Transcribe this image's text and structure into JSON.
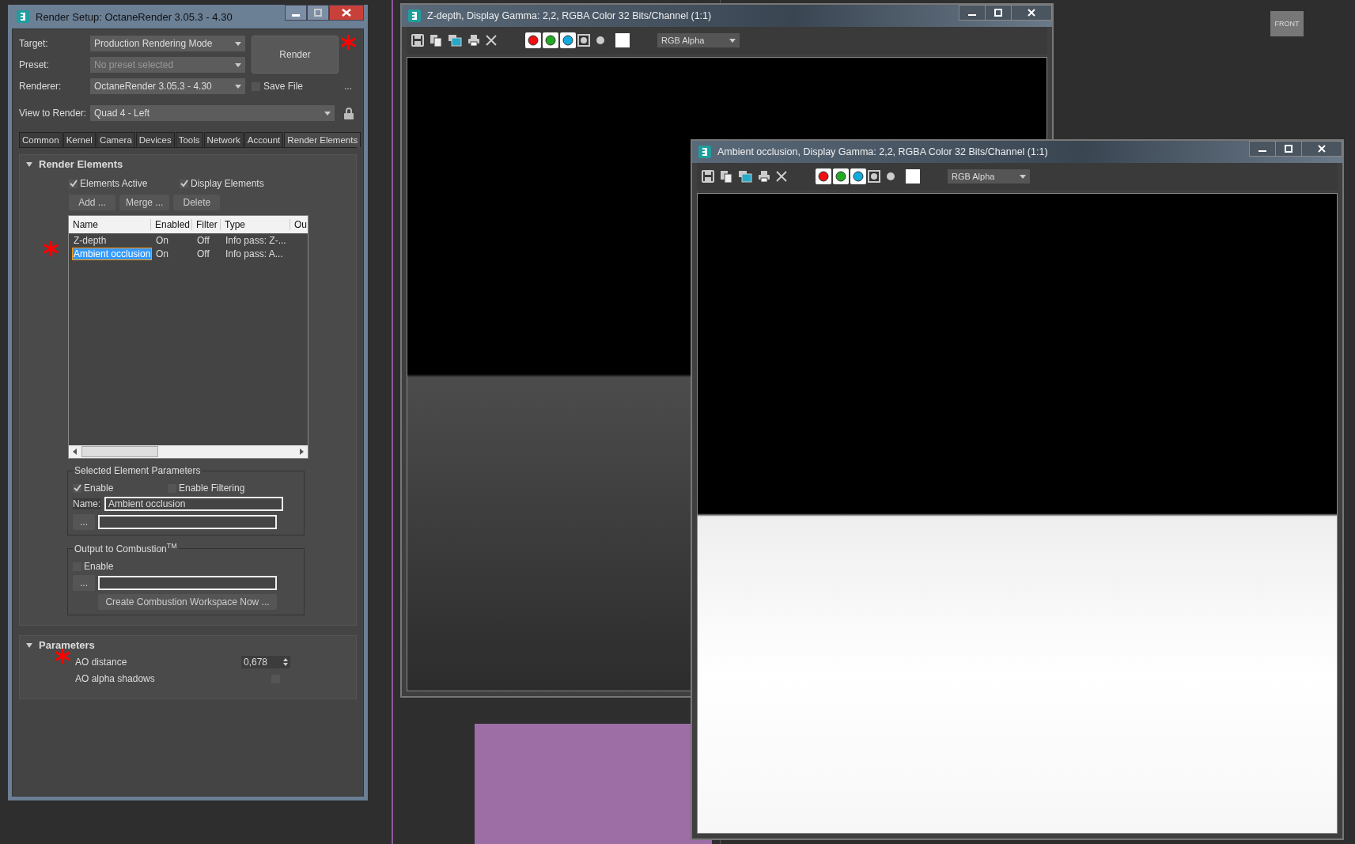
{
  "view_cube": {
    "label": "FRONT"
  },
  "render_setup": {
    "title": "Render Setup: OctaneRender 3.05.3 - 4.30",
    "fields": [
      {
        "label": "Target:",
        "value": "Production Rendering Mode",
        "disabled": false
      },
      {
        "label": "Preset:",
        "value": "No preset selected",
        "disabled": true
      },
      {
        "label": "Renderer:",
        "value": "OctaneRender 3.05.3 - 4.30",
        "disabled": false
      }
    ],
    "render_button": {
      "label": "Render",
      "marker": "*"
    },
    "save_file": {
      "label": "Save File",
      "checked": false
    },
    "more_button": "...",
    "view_to_render": {
      "label": "View to Render:",
      "value": "Quad 4 - Left"
    },
    "tabs": [
      {
        "label": "Common",
        "selected": false
      },
      {
        "label": "Kernel",
        "selected": false
      },
      {
        "label": "Camera",
        "selected": false
      },
      {
        "label": "Devices",
        "selected": false
      },
      {
        "label": "Tools",
        "selected": false
      },
      {
        "label": "Network",
        "selected": false
      },
      {
        "label": "Account",
        "selected": false
      },
      {
        "label": "Render Elements",
        "selected": true
      }
    ],
    "render_elements": {
      "title": "Render Elements",
      "expanded": true,
      "options": [
        {
          "label": "Elements Active",
          "checked": true
        },
        {
          "label": "Display Elements",
          "checked": true
        }
      ],
      "buttons": [
        "Add ...",
        "Merge ...",
        "Delete"
      ],
      "table": {
        "columns": [
          "Name",
          "Enabled",
          "Filter",
          "Type",
          "Ou"
        ],
        "rows": [
          {
            "cells": [
              "Z-depth",
              "On",
              "Off",
              "Info pass: Z-..."
            ],
            "selected": false
          },
          {
            "cells": [
              "Ambient occlusion",
              "On",
              "Off",
              "Info pass: A..."
            ],
            "selected": true,
            "marker": "*"
          }
        ]
      },
      "selected_element_parameters": {
        "title": "Selected Element Parameters",
        "enable": {
          "label": "Enable",
          "checked": true
        },
        "enable_filtering": {
          "label": "Enable Filtering",
          "checked": false
        },
        "name_label": "Name:",
        "name_value": "Ambient occlusion",
        "browse_button": "..."
      },
      "output_to_combustion": {
        "title": "Output to Combustion$^{TM}$",
        "enable": {
          "label": "Enable",
          "checked": false
        },
        "browse_button": "...",
        "create_button": "Create Combustion Workspace Now ..."
      }
    },
    "parameters": {
      "title": "Parameters",
      "expanded": true,
      "rows": [
        {
          "kind": "spinner",
          "label": "AO distance",
          "value": "0,678",
          "marker": "*"
        },
        {
          "kind": "checkbox",
          "label": "AO alpha shadows",
          "checked": false
        }
      ]
    }
  },
  "frame_windows": [
    {
      "title": "Z-depth, Display Gamma: 2,2, RGBA Color 32 Bits/Channel (1:1)",
      "channel": "RGB Alpha",
      "kind": "depth"
    },
    {
      "title": "Ambient occlusion, Display Gamma: 2,2, RGBA Color 32 Bits/Channel (1:1)",
      "channel": "RGB Alpha",
      "kind": "occlusion"
    }
  ]
}
